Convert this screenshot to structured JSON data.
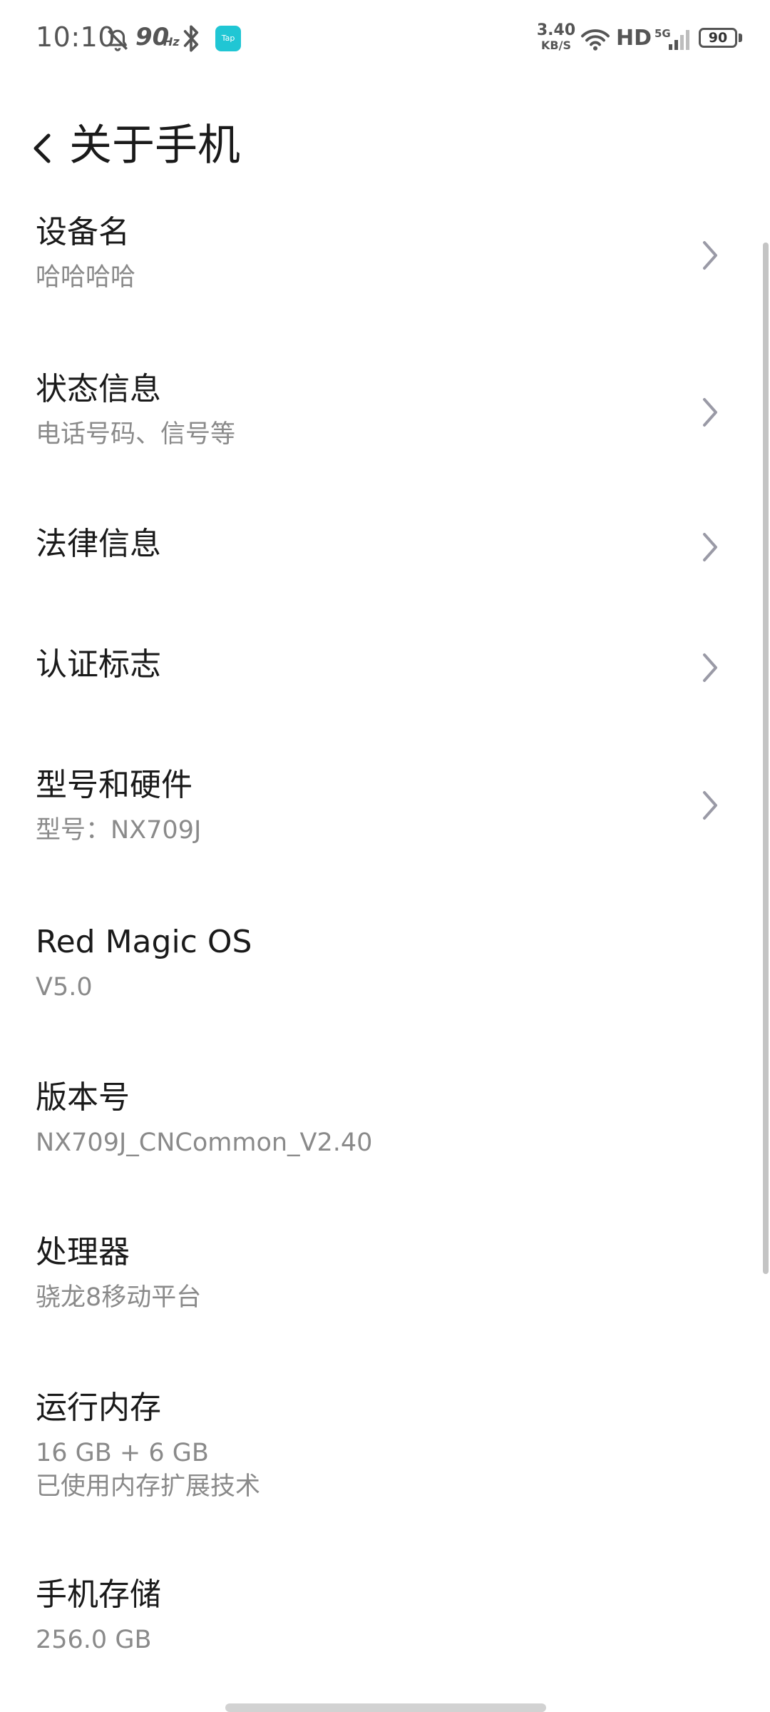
{
  "status_bar": {
    "time": "10:10",
    "refresh_rate_value": "90",
    "refresh_rate_unit": "Hz",
    "app_badge": "Tap",
    "net_speed_value": "3.40",
    "net_speed_unit": "KB/S",
    "hd_label": "HD",
    "network_type": "5G",
    "battery_level": "90",
    "icons": [
      "bell-off-icon",
      "bluetooth-icon",
      "wifi-icon",
      "signal-icon",
      "battery-icon"
    ]
  },
  "header": {
    "back_icon": "chevron-left-icon",
    "title": "关于手机"
  },
  "items": [
    {
      "title": "设备名",
      "subtitle": "哈哈哈哈",
      "has_chevron": true
    },
    {
      "title": "状态信息",
      "subtitle": "电话号码、信号等",
      "has_chevron": true
    },
    {
      "title": "法律信息",
      "has_chevron": true
    },
    {
      "title": "认证标志",
      "has_chevron": true
    },
    {
      "title": "型号和硬件",
      "subtitle": "型号：NX709J",
      "has_chevron": true
    },
    {
      "title": "Red Magic OS",
      "subtitle": "V5.0",
      "has_chevron": false
    },
    {
      "title": "版本号",
      "subtitle": "NX709J_CNCommon_V2.40",
      "has_chevron": false
    },
    {
      "title": "处理器",
      "subtitle": "骁龙8移动平台",
      "has_chevron": false
    },
    {
      "title": "运行内存",
      "subtitle": "16 GB + 6 GB",
      "subtitle2": "已使用内存扩展技术",
      "has_chevron": false
    },
    {
      "title": "手机存储",
      "subtitle": "256.0 GB",
      "has_chevron": false
    }
  ],
  "colors": {
    "title_text": "#1a1a1a",
    "subtitle_text": "#8a8a8a",
    "chevron": "#9a9aa6",
    "app_badge": "#20c6d4",
    "status_icons": "#555555"
  }
}
